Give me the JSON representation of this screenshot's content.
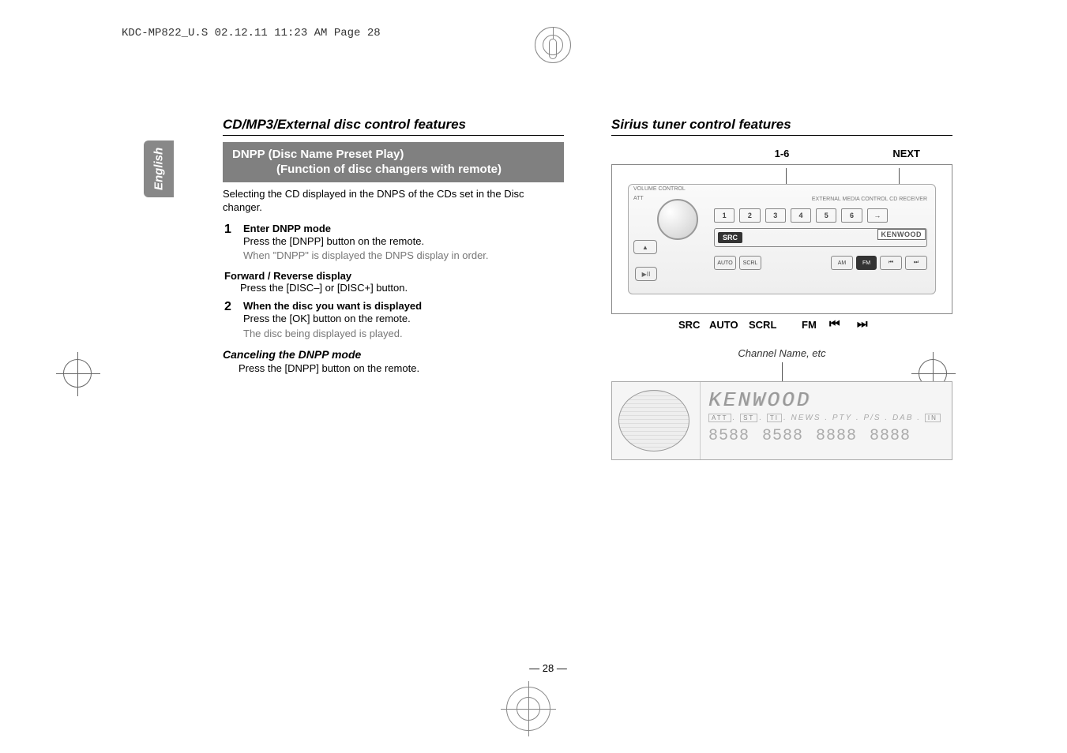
{
  "print_header": "KDC-MP822_U.S  02.12.11  11:23 AM  Page 28",
  "side_tab": "English",
  "page_number": "— 28 —",
  "left": {
    "section_title": "CD/MP3/External disc control features",
    "banner_main": "DNPP (Disc Name Preset Play)",
    "banner_sub": "(Function of disc changers with remote)",
    "lead": "Selecting the CD displayed in the DNPS of the CDs set in the Disc changer.",
    "step1": {
      "num": "1",
      "title": "Enter DNPP mode",
      "text": "Press the [DNPP] button on the remote.",
      "note": "When \"DNPP\" is displayed the DNPS display in order."
    },
    "fwd": {
      "label": "Forward / Reverse display",
      "text": "Press the [DISC–] or [DISC+] button."
    },
    "step2": {
      "num": "2",
      "title": "When the disc you want is displayed",
      "text": "Press the [OK] button on the remote.",
      "note": "The disc being displayed is played."
    },
    "cancel": {
      "head": "Canceling the DNPP mode",
      "body": "Press the [DNPP] button on the remote."
    }
  },
  "right": {
    "section_title": "Sirius tuner control features",
    "labels": {
      "l16": "1-6",
      "next": "NEXT",
      "src": "SRC",
      "auto": "AUTO",
      "scrl": "SCRL",
      "fm": "FM",
      "rw": "⏮",
      "ff": "⏭"
    },
    "faceplate": {
      "src_btn": "SRC",
      "logo": "KENWOOD",
      "nums": [
        "1",
        "2",
        "3",
        "4",
        "5",
        "6",
        "→"
      ],
      "am": "AM",
      "fm": "FM",
      "auto": "AUTO",
      "scrl": "SCRL",
      "rw": "⏮",
      "ff": "⏭",
      "pp": "▶ⅠⅠ",
      "vol": "VOLUME CONTROL",
      "att": "ATT",
      "ext": "EXTERNAL MEDIA CONTROL CD RECEIVER"
    },
    "readout": {
      "label": "Channel Name, etc",
      "main": "KENWOOD",
      "indline": {
        "att": "ATT",
        "st": "ST",
        "ti": "TI",
        "rest": "NEWS . PTY . P/S . DAB .",
        "in": "IN"
      },
      "nums": [
        "8588",
        "8588",
        "8888",
        "8888"
      ]
    }
  }
}
